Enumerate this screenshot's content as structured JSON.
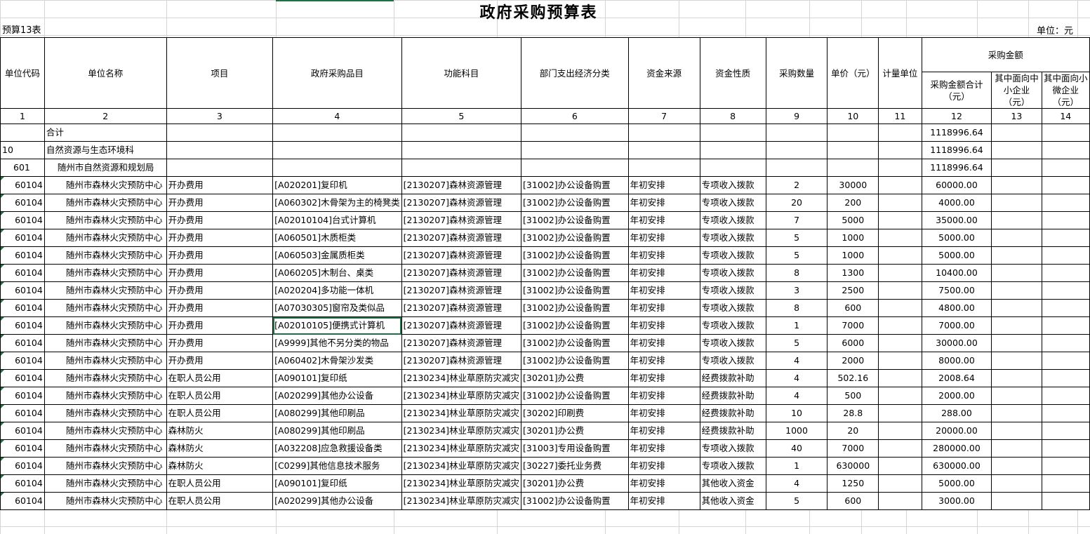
{
  "title": "政府采购预算表",
  "table_no": "预算13表",
  "unit": "单位：元",
  "headers": {
    "unit_code": "单位代码",
    "unit_name": "单位名称",
    "project": "项目",
    "catalog": "政府采购品目",
    "function_subject": "功能科目",
    "econ_class": "部门支出经济分类",
    "fund_source": "资金来源",
    "fund_nature": "资金性质",
    "qty": "采购数量",
    "unit_price": "单价（元）",
    "measure_unit": "计量单位",
    "amount_group": "采购金额",
    "amount_total": "采购金额合计（元）",
    "amount_sme": "其中面向中小企业（元）",
    "amount_micro": "其中面向小微企业（元）"
  },
  "col_numbers": [
    "1",
    "2",
    "3",
    "4",
    "5",
    "6",
    "7",
    "8",
    "9",
    "10",
    "11",
    "12",
    "13",
    "14"
  ],
  "summary_rows": [
    {
      "code": "",
      "name": "合计",
      "total": "1118996.64"
    },
    {
      "code": "10",
      "name": "自然资源与生态环境科",
      "total": "1118996.64"
    },
    {
      "code": "601",
      "name": "随州市自然资源和规划局",
      "total": "1118996.64"
    }
  ],
  "rows": [
    {
      "code": "60104",
      "name": "随州市森林火灾预防中心",
      "project": "开办费用",
      "catalog": "[A020201]复印机",
      "func": "[2130207]森林资源管理",
      "econ": "[31002]办公设备购置",
      "src": "年初安排",
      "nature": "专项收入拨款",
      "qty": "2",
      "price": "30000",
      "unit": "",
      "total": "60000.00"
    },
    {
      "code": "60104",
      "name": "随州市森林火灾预防中心",
      "project": "开办费用",
      "catalog": "[A060302]木骨架为主的椅凳类",
      "func": "[2130207]森林资源管理",
      "econ": "[31002]办公设备购置",
      "src": "年初安排",
      "nature": "专项收入拨款",
      "qty": "20",
      "price": "200",
      "unit": "",
      "total": "4000.00"
    },
    {
      "code": "60104",
      "name": "随州市森林火灾预防中心",
      "project": "开办费用",
      "catalog": "[A02010104]台式计算机",
      "func": "[2130207]森林资源管理",
      "econ": "[31002]办公设备购置",
      "src": "年初安排",
      "nature": "专项收入拨款",
      "qty": "7",
      "price": "5000",
      "unit": "",
      "total": "35000.00"
    },
    {
      "code": "60104",
      "name": "随州市森林火灾预防中心",
      "project": "开办费用",
      "catalog": "[A060501]木质柜类",
      "func": "[2130207]森林资源管理",
      "econ": "[31002]办公设备购置",
      "src": "年初安排",
      "nature": "专项收入拨款",
      "qty": "5",
      "price": "1000",
      "unit": "",
      "total": "5000.00"
    },
    {
      "code": "60104",
      "name": "随州市森林火灾预防中心",
      "project": "开办费用",
      "catalog": "[A060503]金属质柜类",
      "func": "[2130207]森林资源管理",
      "econ": "[31002]办公设备购置",
      "src": "年初安排",
      "nature": "专项收入拨款",
      "qty": "5",
      "price": "1000",
      "unit": "",
      "total": "5000.00"
    },
    {
      "code": "60104",
      "name": "随州市森林火灾预防中心",
      "project": "开办费用",
      "catalog": "[A060205]木制台、桌类",
      "func": "[2130207]森林资源管理",
      "econ": "[31002]办公设备购置",
      "src": "年初安排",
      "nature": "专项收入拨款",
      "qty": "8",
      "price": "1300",
      "unit": "",
      "total": "10400.00"
    },
    {
      "code": "60104",
      "name": "随州市森林火灾预防中心",
      "project": "开办费用",
      "catalog": "[A020204]多功能一体机",
      "func": "[2130207]森林资源管理",
      "econ": "[31002]办公设备购置",
      "src": "年初安排",
      "nature": "专项收入拨款",
      "qty": "3",
      "price": "2500",
      "unit": "",
      "total": "7500.00"
    },
    {
      "code": "60104",
      "name": "随州市森林火灾预防中心",
      "project": "开办费用",
      "catalog": "[A07030305]窗帘及类似品",
      "func": "[2130207]森林资源管理",
      "econ": "[31002]办公设备购置",
      "src": "年初安排",
      "nature": "专项收入拨款",
      "qty": "8",
      "price": "600",
      "unit": "",
      "total": "4800.00"
    },
    {
      "code": "60104",
      "name": "随州市森林火灾预防中心",
      "project": "开办费用",
      "catalog": "[A02010105]便携式计算机",
      "func": "[2130207]森林资源管理",
      "econ": "[31002]办公设备购置",
      "src": "年初安排",
      "nature": "专项收入拨款",
      "qty": "1",
      "price": "7000",
      "unit": "",
      "total": "7000.00",
      "selected": true
    },
    {
      "code": "60104",
      "name": "随州市森林火灾预防中心",
      "project": "开办费用",
      "catalog": "[A9999]其他不另分类的物品",
      "func": "[2130207]森林资源管理",
      "econ": "[31002]办公设备购置",
      "src": "年初安排",
      "nature": "专项收入拨款",
      "qty": "5",
      "price": "6000",
      "unit": "",
      "total": "30000.00"
    },
    {
      "code": "60104",
      "name": "随州市森林火灾预防中心",
      "project": "开办费用",
      "catalog": "[A060402]木骨架沙发类",
      "func": "[2130207]森林资源管理",
      "econ": "[31002]办公设备购置",
      "src": "年初安排",
      "nature": "专项收入拨款",
      "qty": "4",
      "price": "2000",
      "unit": "",
      "total": "8000.00"
    },
    {
      "code": "60104",
      "name": "随州市森林火灾预防中心",
      "project": "在职人员公用",
      "catalog": "[A090101]复印纸",
      "func": "[2130234]林业草原防灾减灾",
      "econ": "[30201]办公费",
      "src": "年初安排",
      "nature": "经费拨款补助",
      "qty": "4",
      "price": "502.16",
      "unit": "",
      "total": "2008.64"
    },
    {
      "code": "60104",
      "name": "随州市森林火灾预防中心",
      "project": "在职人员公用",
      "catalog": "[A020299]其他办公设备",
      "func": "[2130234]林业草原防灾减灾",
      "econ": "[31002]办公设备购置",
      "src": "年初安排",
      "nature": "经费拨款补助",
      "qty": "4",
      "price": "500",
      "unit": "",
      "total": "2000.00"
    },
    {
      "code": "60104",
      "name": "随州市森林火灾预防中心",
      "project": "在职人员公用",
      "catalog": "[A080299]其他印刷品",
      "func": "[2130234]林业草原防灾减灾",
      "econ": "[30202]印刷费",
      "src": "年初安排",
      "nature": "经费拨款补助",
      "qty": "10",
      "price": "28.8",
      "unit": "",
      "total": "288.00"
    },
    {
      "code": "60104",
      "name": "随州市森林火灾预防中心",
      "project": "森林防火",
      "catalog": "[A080299]其他印刷品",
      "func": "[2130234]林业草原防灾减灾",
      "econ": "[30201]办公费",
      "src": "年初安排",
      "nature": "经费拨款补助",
      "qty": "1000",
      "price": "20",
      "unit": "",
      "total": "20000.00"
    },
    {
      "code": "60104",
      "name": "随州市森林火灾预防中心",
      "project": "森林防火",
      "catalog": "[A032208]应急救援设备类",
      "func": "[2130234]林业草原防灾减灾",
      "econ": "[31003]专用设备购置",
      "src": "年初安排",
      "nature": "专项收入拨款",
      "qty": "40",
      "price": "7000",
      "unit": "",
      "total": "280000.00"
    },
    {
      "code": "60104",
      "name": "随州市森林火灾预防中心",
      "project": "森林防火",
      "catalog": "[C0299]其他信息技术服务",
      "func": "[2130234]林业草原防灾减灾",
      "econ": "[30227]委托业务费",
      "src": "年初安排",
      "nature": "专项收入拨款",
      "qty": "1",
      "price": "630000",
      "unit": "",
      "total": "630000.00"
    },
    {
      "code": "60104",
      "name": "随州市森林火灾预防中心",
      "project": "在职人员公用",
      "catalog": "[A090101]复印纸",
      "func": "[2130234]林业草原防灾减灾",
      "econ": "[30201]办公费",
      "src": "年初安排",
      "nature": "其他收入资金",
      "qty": "4",
      "price": "1250",
      "unit": "",
      "total": "5000.00"
    },
    {
      "code": "60104",
      "name": "随州市森林火灾预防中心",
      "project": "在职人员公用",
      "catalog": "[A020299]其他办公设备",
      "func": "[2130234]林业草原防灾减灾",
      "econ": "[31002]办公设备购置",
      "src": "年初安排",
      "nature": "其他收入资金",
      "qty": "5",
      "price": "600",
      "unit": "",
      "total": "3000.00"
    }
  ],
  "colors": {
    "grid": "#d4d4d4",
    "border": "#000000",
    "selection": "#1e7145"
  }
}
